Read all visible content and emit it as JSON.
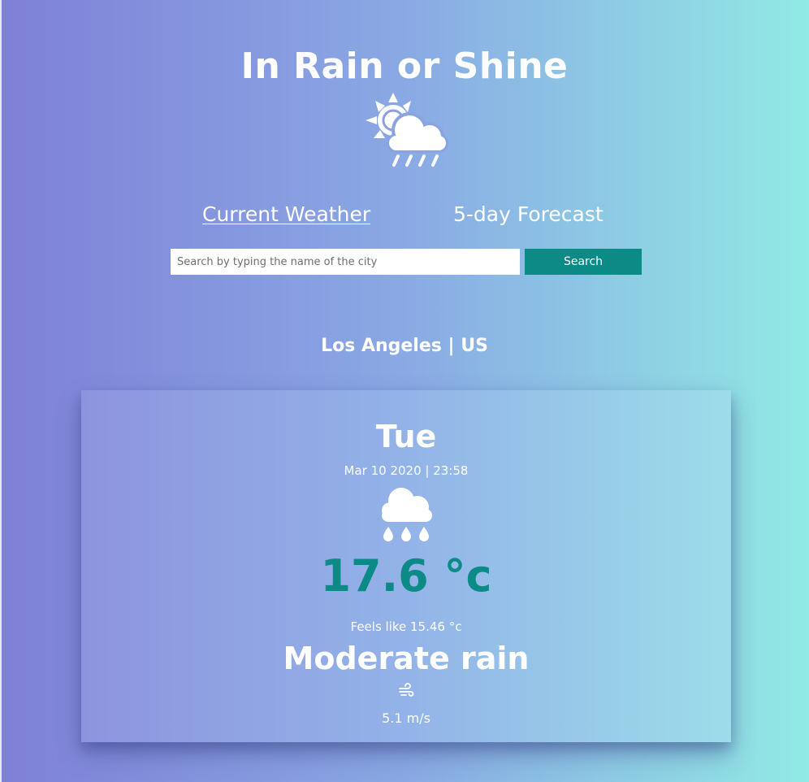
{
  "app": {
    "title": "In Rain or Shine",
    "logo_icon": "sun-cloud-rain-icon"
  },
  "tabs": [
    {
      "label": "Current Weather",
      "active": true
    },
    {
      "label": "5-day Forecast",
      "active": false
    }
  ],
  "search": {
    "placeholder": "Search by typing the name of the city",
    "value": "",
    "button_label": "Search"
  },
  "location": "Los Angeles | US",
  "weather": {
    "day": "Tue",
    "date": "Mar 10 2020 | 23:58",
    "condition_icon": "cloud-rain-drops-icon",
    "temperature": "17.6 °c",
    "feels_like": "Feels like 15.46 °c",
    "description": "Moderate rain",
    "wind_icon": "wind-icon",
    "wind_speed": "5.1 m/s"
  },
  "colors": {
    "accent": "#0b8a86",
    "background_start": "#7f80d7",
    "background_end": "#91eae4",
    "text": "#ffffff"
  }
}
